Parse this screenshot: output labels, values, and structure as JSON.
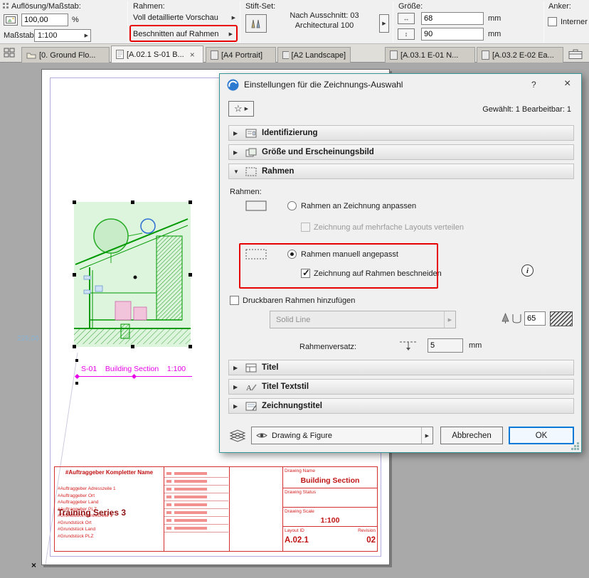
{
  "toolbar": {
    "resolution": {
      "label": "Auflösung/Maßstab:",
      "value": "100,00",
      "percent": "%",
      "scale_label": "Maßstab:",
      "scale_value": "1:100"
    },
    "frame": {
      "label": "Rahmen:",
      "preview_button": "Voll detaillierte Vorschau",
      "clip_button": "Beschnitten auf Rahmen"
    },
    "pen_set": {
      "label": "Stift-Set:",
      "line1": "Nach Ausschnitt: 03",
      "line2": "Architectural 100"
    },
    "size": {
      "label": "Größe:",
      "width": "68",
      "height": "90",
      "unit": "mm"
    },
    "anchor": {
      "label": "Anker:",
      "value": "Interner Ursp..."
    }
  },
  "tabbar": {
    "tabs": [
      {
        "label": "[0. Ground Flo..."
      },
      {
        "label": "[A.02.1 S-01 B...",
        "close": "×"
      },
      {
        "label": "[A4 Portrait]"
      },
      {
        "label": "[A2 Landscape]"
      },
      {
        "label": "[A.03.1 E-01 N..."
      },
      {
        "label": "[A.03.2 E-02 Ea..."
      }
    ]
  },
  "canvas": {
    "dimension_text": "225,00",
    "origin_marker": "×",
    "drawing_title": {
      "id": "S-01",
      "name": "Building Section",
      "scale": "1:100"
    }
  },
  "titleblock": {
    "client_header": "#Auftraggeber Kompletter Name",
    "lines": [
      "#Auftraggeber Adresszeile 1",
      "#Auftraggeber Ort",
      "#Auftraggeber Land",
      "#Auftraggeber PLZ",
      "#Grundstück Adresszeile 1",
      "#Grundstück Ort",
      "#Grundstück Land",
      "#Grundstück PLZ"
    ],
    "project_title": "Training Series 3",
    "fields": {
      "drawing_name_label": "Drawing Name",
      "drawing_name": "Building Section",
      "drawing_status_label": "Drawing Status",
      "drawing_scale_label": "Drawing Scale",
      "drawing_scale": "1:100",
      "layout_id_label": "Layout ID",
      "layout_id": "A.02.1",
      "revision_label": "Revision",
      "revision": "02"
    }
  },
  "dialog": {
    "title": "Einstellungen für die Zeichnungs-Auswahl",
    "help_button": "?",
    "close_button": "×",
    "selection_info": "Gewählt: 1 Bearbeitbar: 1",
    "sections": {
      "identification": "Identifizierung",
      "size_appearance": "Größe und Erscheinungsbild",
      "frame": "Rahmen",
      "title": "Titel",
      "title_textstyle": "Titel Textstil",
      "drawing_title": "Zeichnungstitel"
    },
    "frame_panel": {
      "group_label": "Rahmen:",
      "fit_frame_radio": "Rahmen an Zeichnung anpassen",
      "spread_checkbox": "Zeichnung auf mehrfache Layouts verteilen",
      "manual_frame_radio": "Rahmen manuell angepasst",
      "clip_checkbox": "Zeichnung auf Rahmen beschneiden",
      "printable_checkbox": "Druckbaren Rahmen hinzufügen",
      "line_type": "Solid Line",
      "pen_number": "65",
      "offset_label": "Rahmenversatz:",
      "offset_value": "5",
      "offset_unit": "mm"
    },
    "footer": {
      "layer_name": "Drawing & Figure",
      "cancel_button": "Abbrechen",
      "ok_button": "OK"
    }
  },
  "colors": {
    "annotation_red": "#e60000",
    "drawing_green": "#009900",
    "selection_magenta": "#e800e8",
    "titleblock_red": "#d42020",
    "ok_focus_blue": "#0078d7"
  }
}
